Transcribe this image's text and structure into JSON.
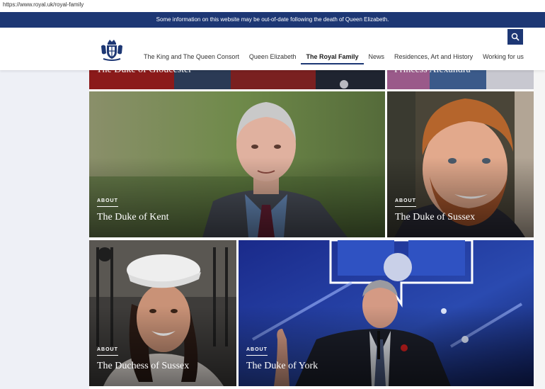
{
  "browser": {
    "url": "https://www.royal.uk/royal-family"
  },
  "banner": {
    "text": "Some information on this website may be out-of-date following the death of Queen Elizabeth."
  },
  "nav": {
    "items": [
      {
        "label": "The King and The Queen Consort",
        "active": false
      },
      {
        "label": "Queen Elizabeth",
        "active": false
      },
      {
        "label": "The Royal Family",
        "active": true
      },
      {
        "label": "News",
        "active": false
      },
      {
        "label": "Residences, Art and History",
        "active": false
      },
      {
        "label": "Working for us",
        "active": false
      }
    ],
    "search_icon": "search-icon",
    "crest_icon": "royal-crest-icon",
    "accent_color": "#1d3774"
  },
  "cards": {
    "top_left": {
      "name": "The Duke of Gloucester"
    },
    "top_right": {
      "name": "Princess Alexandra"
    },
    "kent": {
      "kicker": "ABOUT",
      "name": "The Duke of Kent"
    },
    "sussex_duke": {
      "kicker": "ABOUT",
      "name": "The Duke of Sussex"
    },
    "sussex_duchess": {
      "kicker": "ABOUT",
      "name": "The Duchess of Sussex"
    },
    "york": {
      "kicker": "ABOUT",
      "name": "The Duke of York"
    }
  }
}
